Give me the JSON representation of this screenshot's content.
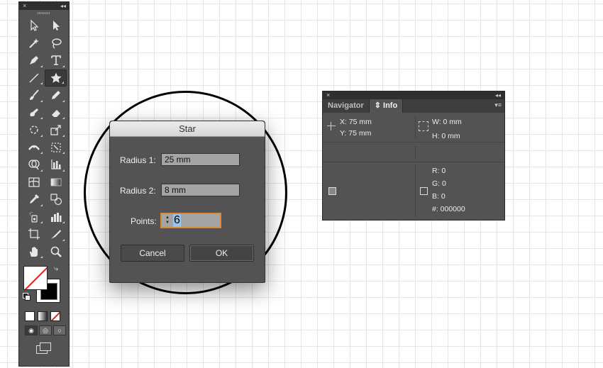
{
  "tools_panel": {
    "close_glyph": "×",
    "collapse_glyph": "◂◂",
    "selected_tool": "star-tool"
  },
  "star_dialog": {
    "title": "Star",
    "radius1_label": "Radius 1:",
    "radius1_value": "25 mm",
    "radius2_label": "Radius 2:",
    "radius2_value": "8 mm",
    "points_label": "Points:",
    "points_value": "6",
    "cancel_label": "Cancel",
    "ok_label": "OK"
  },
  "info_panel": {
    "close_glyph": "×",
    "collapse_glyph": "◂◂",
    "tabs": [
      {
        "label": "Navigator",
        "active": false
      },
      {
        "label": "⇕ Info",
        "active": true
      }
    ],
    "menu_glyph": "▾≡",
    "x": "X:  75 mm",
    "y": "Y:  75 mm",
    "w": "W:   0 mm",
    "h": "H:   0 mm",
    "r": "R: 0",
    "g": "G: 0",
    "b": "B: 0",
    "hex": "#: 000000"
  },
  "colors": {
    "panel_bg": "#535353",
    "dialog_title_bg": "#e2e2e2",
    "focus_ring": "#d88a36",
    "fill_slash": "#e02020"
  }
}
